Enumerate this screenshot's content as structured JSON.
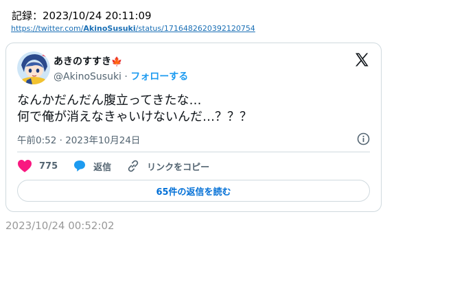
{
  "record": {
    "label": "記録：2023/10/24 20:11:09"
  },
  "source_url": {
    "prefix": "https://twitter.com/",
    "user": "AkinoSusuki",
    "suffix": "/status/1716482620392120754"
  },
  "tweet": {
    "display_name": "あきのすすき",
    "name_emoji": "🍁",
    "handle": "@AkinoSusuki",
    "separator": "·",
    "follow_label": "フォローする",
    "text_line1": "なんかだんだん腹立ってきたな…",
    "text_line2": "何で俺が消えなきゃいけないんだ…？？？",
    "timestamp": "午前0:52 · 2023年10月24日",
    "likes": "775",
    "reply_label": "返信",
    "copy_link_label": "リンクをコピー",
    "read_replies_label": "65件の返信を読む"
  },
  "archive_date": "2023/10/24 00:52:02",
  "colors": {
    "like": "#f91880",
    "reply": "#1d9bf0",
    "link": "#1d9bf0"
  },
  "icons": {
    "logo": "x-logo-icon",
    "info": "info-icon",
    "like": "heart-icon",
    "reply": "speech-bubble-icon",
    "copy_link": "link-icon"
  }
}
